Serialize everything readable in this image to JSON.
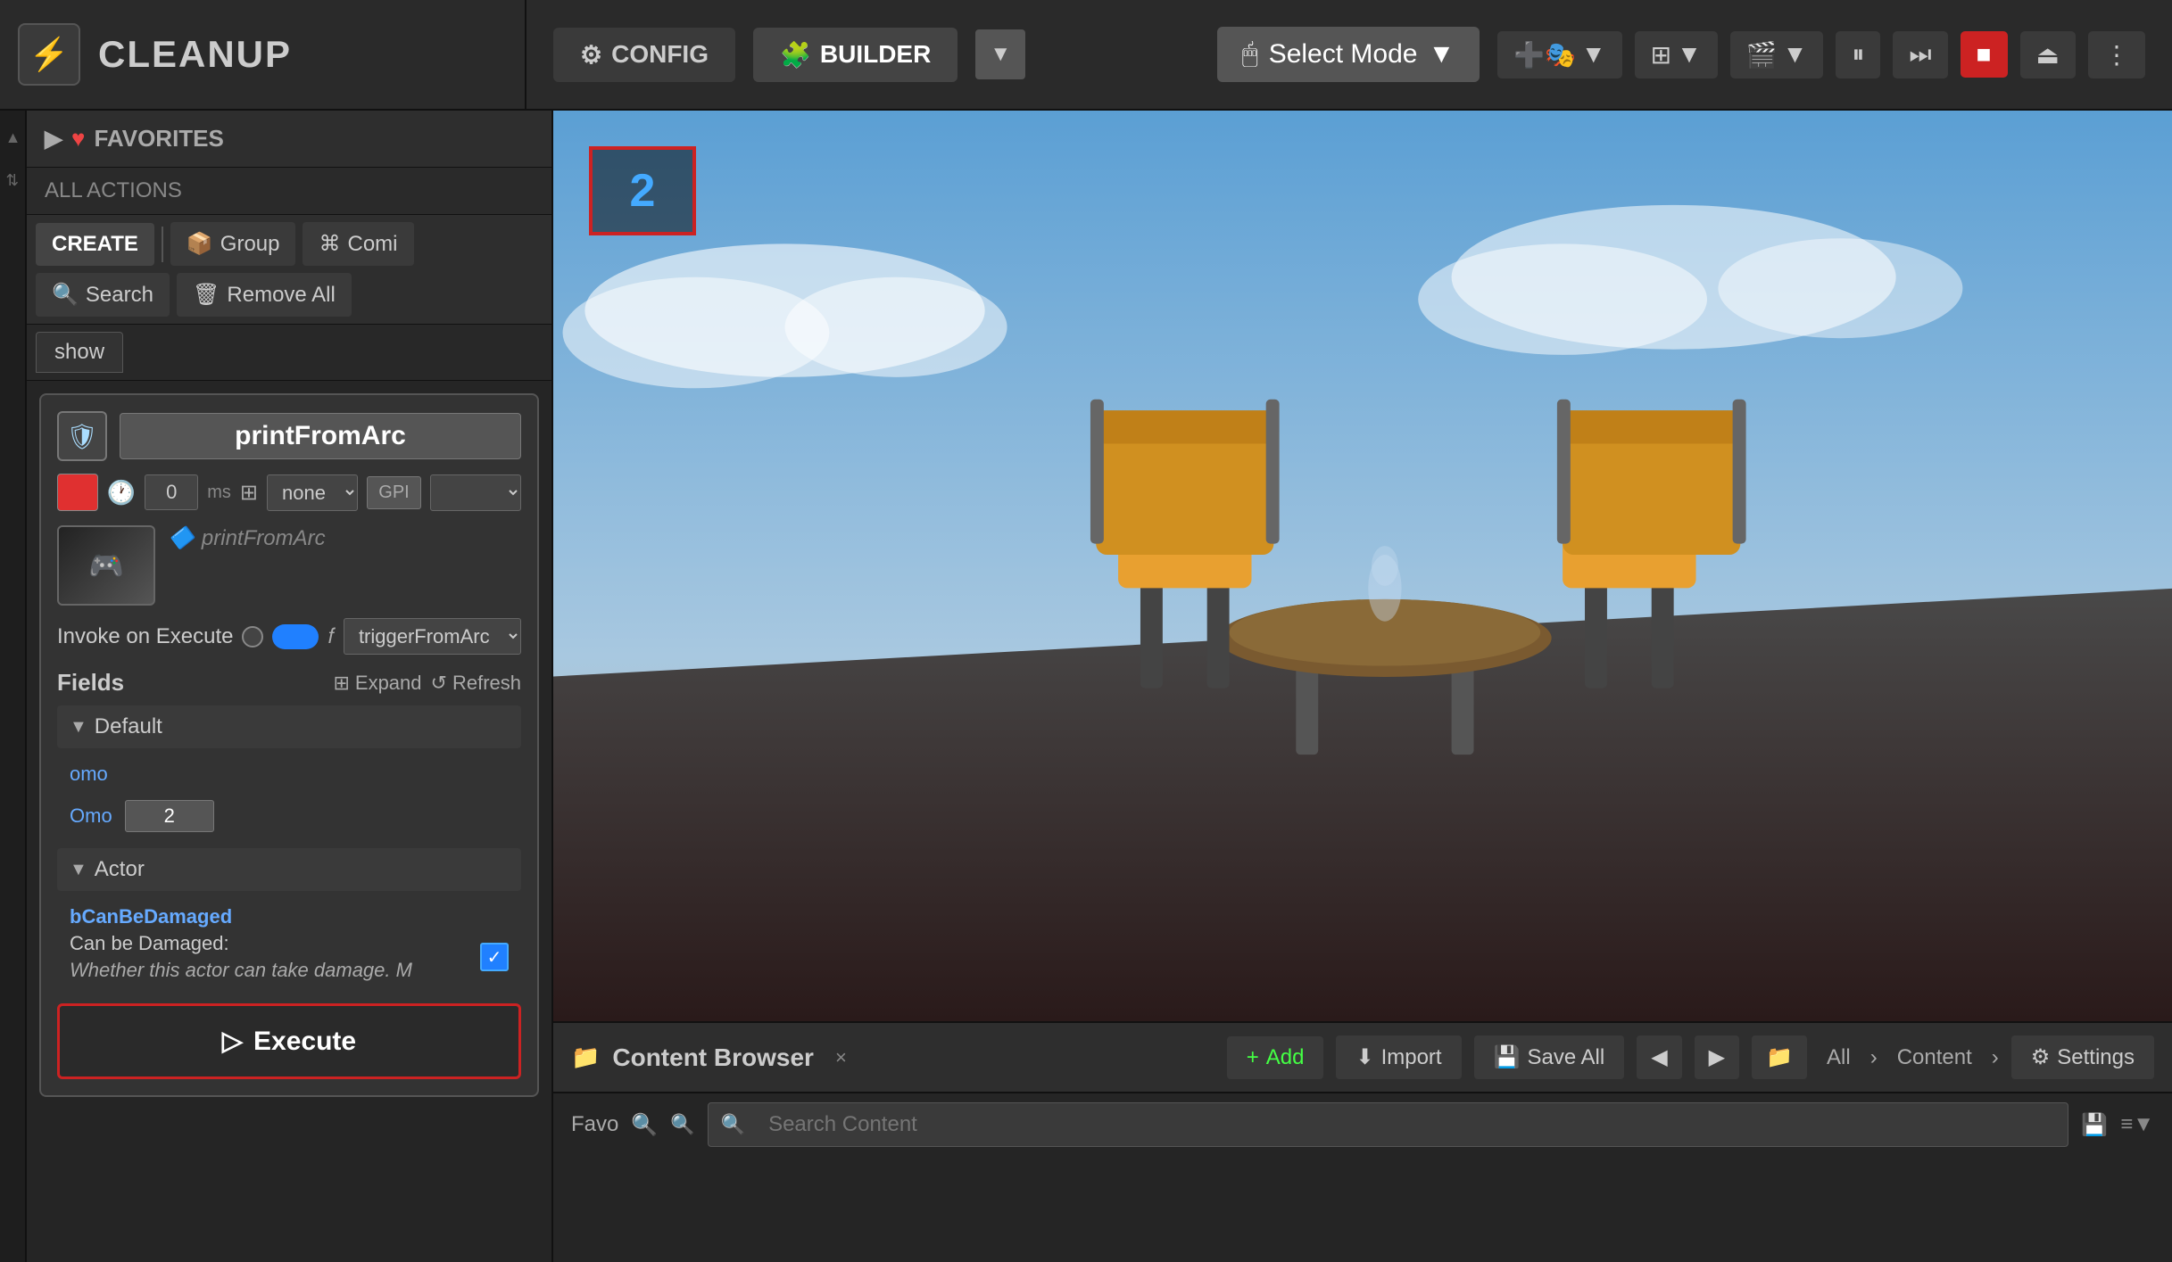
{
  "app": {
    "title": "CLEANUP",
    "icon": "⚡"
  },
  "topbar": {
    "config_label": "CONFIG",
    "builder_label": "BUILDER",
    "select_mode_label": "Select Mode",
    "dropdown_arrow": "▼"
  },
  "toolbar_icons": {
    "pause": "⏸",
    "step": "⏭",
    "stop": "■",
    "eject": "⏏",
    "more": "⋮"
  },
  "left_panel": {
    "favorites_label": "FAVORITES",
    "all_actions_label": "ALL ACTIONS",
    "create_label": "CREATE",
    "group_label": "Group",
    "command_label": "Comi",
    "search_label": "Search",
    "remove_all_label": "Remove All",
    "show_tab_label": "show"
  },
  "node_card": {
    "title": "printFromArc",
    "color": "#e03030",
    "timer_value": "0",
    "timer_unit": "ms",
    "grid_value": "none",
    "invoke_label": "Invoke on Execute",
    "invoke_fn": "triggerFromArc",
    "ref_label": "printFromArc",
    "fields_label": "Fields",
    "expand_label": "Expand",
    "refresh_label": "Refresh",
    "default_section": "Default",
    "field_omo_label": "omo",
    "field_Omo_label": "Omo",
    "field_omo_value": "2",
    "actor_section": "Actor",
    "bcan_label": "bCanBeDamaged",
    "can_damaged_label": "Can be Damaged:",
    "can_damaged_desc": "Whether this actor can take damage. M",
    "execute_label": "Execute"
  },
  "viewport": {
    "badge_number": "2"
  },
  "content_browser": {
    "title": "Content Browser",
    "close": "×",
    "add_label": "Add",
    "import_label": "Import",
    "save_all_label": "Save All",
    "back_label": "◀",
    "forward_label": "▶",
    "folder_label": "📁",
    "all_label": "All",
    "chevron_right": "›",
    "content_label": "Content",
    "chevron_right2": "›",
    "settings_label": "Settings",
    "favo_label": "Favo",
    "search_placeholder": "Search Content"
  }
}
